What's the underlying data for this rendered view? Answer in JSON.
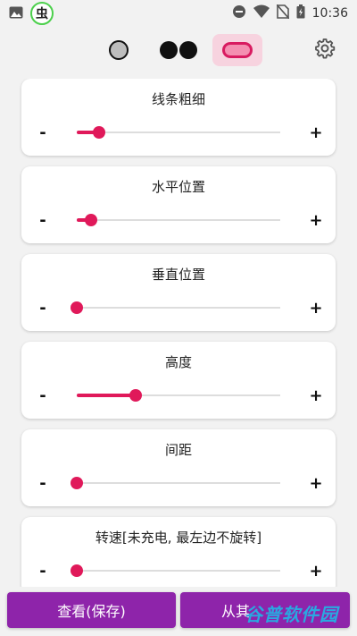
{
  "status_bar": {
    "time": "10:36",
    "app_badge": "虫",
    "icons": [
      "image-icon",
      "dnd-icon",
      "wifi-icon",
      "no-sim-icon",
      "battery-icon"
    ]
  },
  "toolbar": {
    "modes": [
      "single-dot",
      "double-dot",
      "capsule"
    ],
    "selected": "capsule",
    "accent": "#e0195a"
  },
  "controls": [
    {
      "label": "线条粗细",
      "value": 0.11
    },
    {
      "label": "水平位置",
      "value": 0.07
    },
    {
      "label": "垂直位置",
      "value": 0.0
    },
    {
      "label": "高度",
      "value": 0.29
    },
    {
      "label": "间距",
      "value": 0.0
    },
    {
      "label": "转速[未充电, 最左边不旋转]",
      "value": 0.0
    }
  ],
  "buttons": {
    "view_save": "查看(保存)",
    "other": "从其"
  },
  "watermark": "谷普软件园",
  "colors": {
    "button": "#8e24aa",
    "slider": "#e0195a"
  }
}
